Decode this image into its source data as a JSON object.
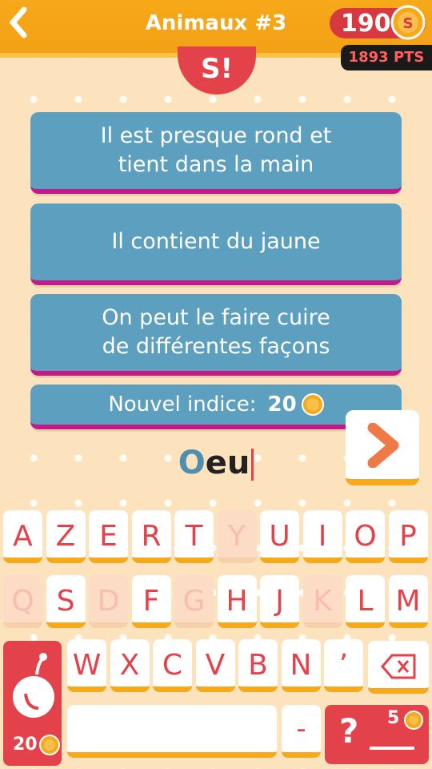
{
  "header": {
    "back": "‹",
    "title": "Animaux #3",
    "coins": "190",
    "points": "1893 PTS"
  },
  "logo": "S!",
  "clues": [
    {
      "line1": "Il est presque rond et",
      "line2": "tient dans la main"
    },
    {
      "line1": "Il contient du jaune",
      "line2": ""
    },
    {
      "line1": "On peut le faire cuire",
      "line2": "de différentes façons"
    }
  ],
  "hint": {
    "label": "Nouvel indice:",
    "cost": "20"
  },
  "answer": {
    "first": "O",
    "rest": "eu"
  },
  "keyboard": {
    "row1": [
      "A",
      "Z",
      "E",
      "R",
      "T",
      "Y",
      "U",
      "I",
      "O",
      "P"
    ],
    "row2": [
      "Q",
      "S",
      "D",
      "F",
      "G",
      "H",
      "J",
      "K",
      "L",
      "M"
    ],
    "row3": [
      "W",
      "X",
      "C",
      "V",
      "B",
      "N",
      "’"
    ],
    "disabled": [
      "Y",
      "Q",
      "D",
      "G",
      "K"
    ]
  },
  "bomb": {
    "cost": "20"
  },
  "dash_key": "-",
  "help": {
    "label": "?",
    "cost": "5"
  },
  "colors": {
    "accent": "#e4424a",
    "card": "#5d9fbe",
    "orange": "#f6a91a",
    "magenta": "#c21b87"
  }
}
